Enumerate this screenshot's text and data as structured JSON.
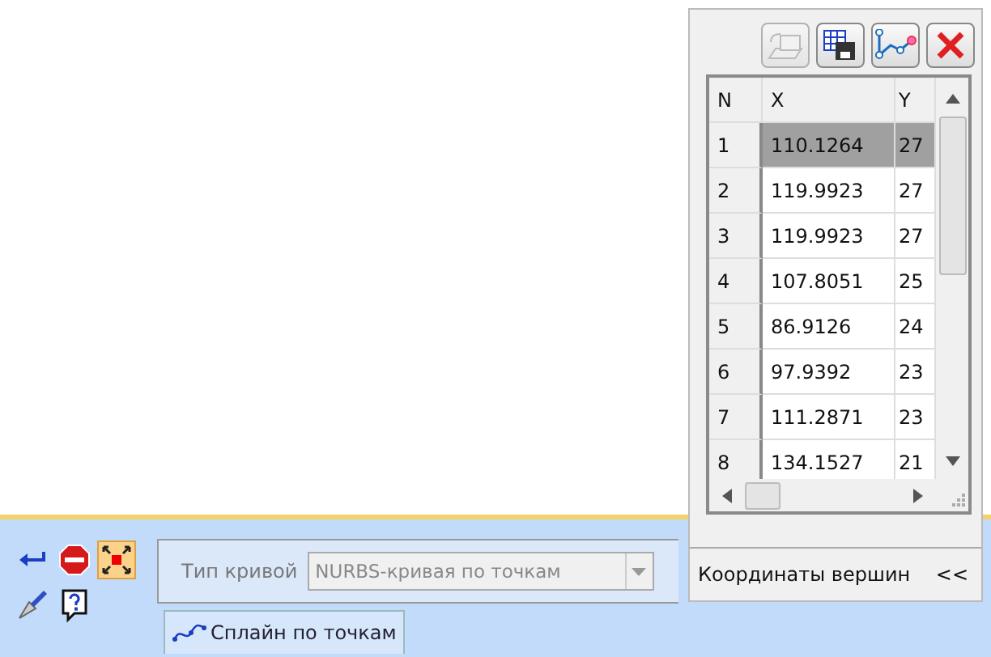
{
  "toolbar": {
    "buttons": [
      {
        "kind": "form",
        "active": false
      },
      {
        "kind": "stop",
        "active": false
      },
      {
        "kind": "fit",
        "active": true
      },
      {
        "kind": "brush",
        "active": false
      },
      {
        "kind": "help",
        "active": false
      }
    ]
  },
  "properties": {
    "curve_type": {
      "label": "Тип кривой",
      "value": "NURBS-кривая по точкам",
      "disabled": true
    }
  },
  "tabs": [
    {
      "label": "Сплайн по точкам",
      "selected": true
    }
  ],
  "vertex_panel": {
    "tools": [
      {
        "kind": "import",
        "disabled": true
      },
      {
        "kind": "save",
        "disabled": false
      },
      {
        "kind": "polyline",
        "disabled": false
      },
      {
        "kind": "delete",
        "disabled": false
      }
    ],
    "table": {
      "columns": [
        "N",
        "X",
        "Y"
      ],
      "rows": [
        {
          "cells": [
            "1",
            "110.1264",
            "27"
          ],
          "selected": true
        },
        {
          "cells": [
            "2",
            "119.9923",
            "27"
          ],
          "selected": false
        },
        {
          "cells": [
            "3",
            "119.9923",
            "27"
          ],
          "selected": false
        },
        {
          "cells": [
            "4",
            "107.8051",
            "25"
          ],
          "selected": false
        },
        {
          "cells": [
            "5",
            "86.9126",
            "24"
          ],
          "selected": false
        },
        {
          "cells": [
            "6",
            "97.9392",
            "23"
          ],
          "selected": false
        },
        {
          "cells": [
            "7",
            "111.2871",
            "23"
          ],
          "selected": false
        },
        {
          "cells": [
            "8",
            "134.1527",
            "21"
          ],
          "selected": false
        }
      ]
    },
    "footer": {
      "title": "Координаты вершин",
      "collapse": "<<"
    }
  }
}
